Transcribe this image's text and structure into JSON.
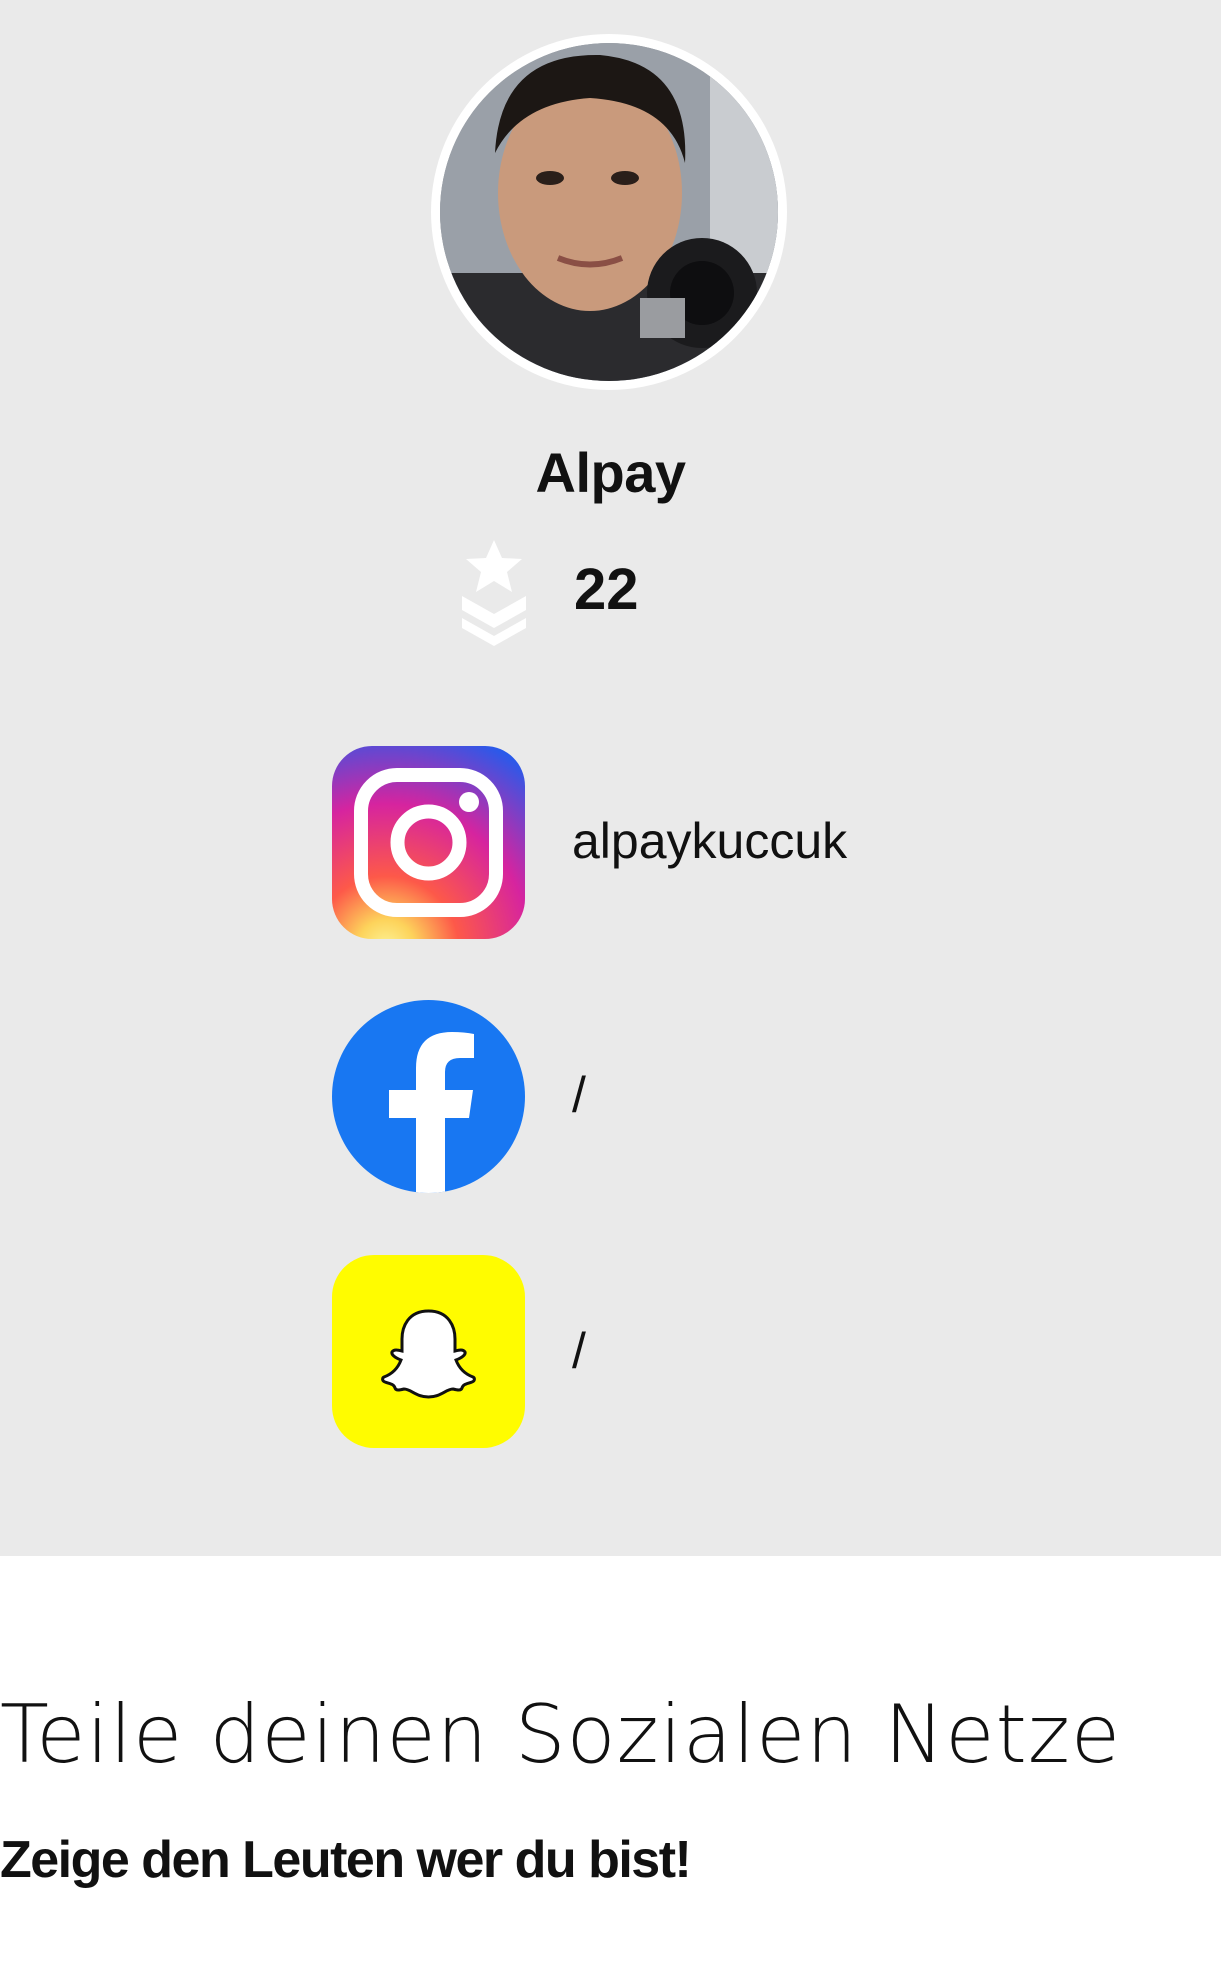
{
  "profile": {
    "name": "Alpay",
    "rank_icon": "military-rank-star-chevrons-icon",
    "rank_value": "22",
    "avatar_icon": "profile-photo-avatar"
  },
  "socials": [
    {
      "platform": "instagram",
      "icon": "instagram-icon",
      "handle": "alpaykuccuk",
      "color": "#d6249f"
    },
    {
      "platform": "facebook",
      "icon": "facebook-icon",
      "handle": "/",
      "color": "#1877f2"
    },
    {
      "platform": "snapchat",
      "icon": "snapchat-icon",
      "handle": "/",
      "color": "#fffc00"
    }
  ],
  "promo": {
    "headline": "Teile deinen Sozialen Netze",
    "subline": "Zeige den Leuten wer du bist!"
  },
  "colors": {
    "panel_background": "#eaeaea",
    "page_background": "#ffffff",
    "text": "#111111"
  }
}
